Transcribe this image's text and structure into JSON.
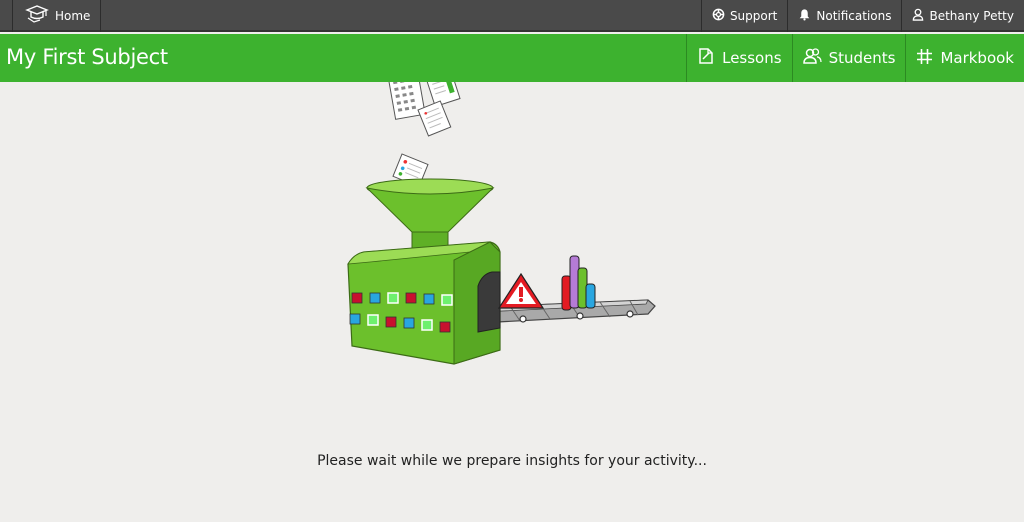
{
  "topbar": {
    "home_label": "Home",
    "support_label": "Support",
    "notifications_label": "Notifications",
    "user_name": "Bethany Petty"
  },
  "subject": {
    "title": "My First Subject",
    "nav": {
      "lessons_label": "Lessons",
      "students_label": "Students",
      "markbook_label": "Markbook"
    }
  },
  "status": {
    "message": "Please wait while we prepare insights for your activity..."
  },
  "colors": {
    "topbar": "#4a4a4a",
    "subject_bar": "#3db22f",
    "background": "#efeeec"
  }
}
